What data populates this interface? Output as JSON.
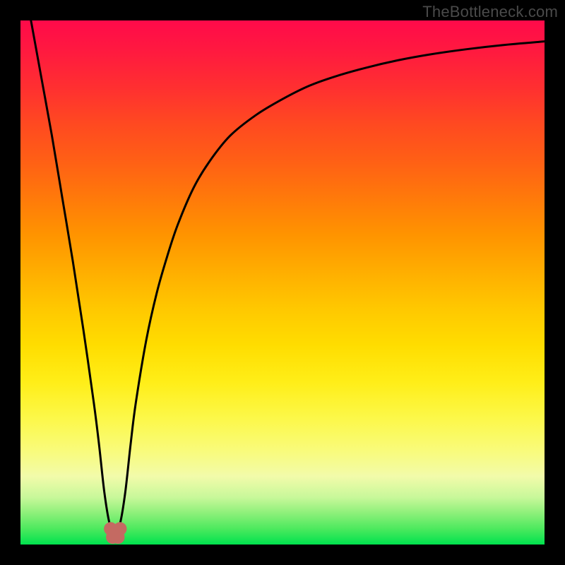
{
  "watermark": {
    "text": "TheBottleneck.com"
  },
  "chart_data": {
    "type": "line",
    "title": "",
    "xlabel": "",
    "ylabel": "",
    "xlim": [
      0,
      100
    ],
    "ylim": [
      0,
      100
    ],
    "grid": false,
    "legend": false,
    "background_gradient": {
      "top_color": "#ff0a4a",
      "bottom_color": "#00e24e",
      "meaning": "0 at bottom (good/green), 100 at top (bad/red)"
    },
    "series": [
      {
        "name": "curve",
        "color": "#000000",
        "x": [
          2,
          4,
          6,
          8,
          10,
          12,
          14,
          15,
          16,
          17,
          18,
          19,
          20,
          21,
          22,
          24,
          26,
          28,
          30,
          33,
          36,
          40,
          45,
          50,
          55,
          60,
          66,
          72,
          78,
          85,
          92,
          100
        ],
        "y": [
          100,
          89,
          78,
          66,
          54,
          41,
          27,
          19,
          10,
          4,
          2,
          4,
          10,
          19,
          27,
          39,
          48,
          55,
          61,
          68,
          73,
          78,
          82,
          85,
          87.5,
          89.3,
          91,
          92.4,
          93.5,
          94.5,
          95.3,
          96
        ]
      }
    ],
    "markers": [
      {
        "name": "dip-marker-left",
        "x": 17.2,
        "y": 3.0,
        "color": "#c46a62",
        "size": 11
      },
      {
        "name": "dip-marker-right",
        "x": 19.0,
        "y": 3.0,
        "color": "#c46a62",
        "size": 11
      },
      {
        "name": "dip-marker-bottom-left",
        "x": 17.6,
        "y": 1.4,
        "color": "#c46a62",
        "size": 11
      },
      {
        "name": "dip-marker-bottom-right",
        "x": 18.6,
        "y": 1.4,
        "color": "#c46a62",
        "size": 11
      }
    ]
  }
}
